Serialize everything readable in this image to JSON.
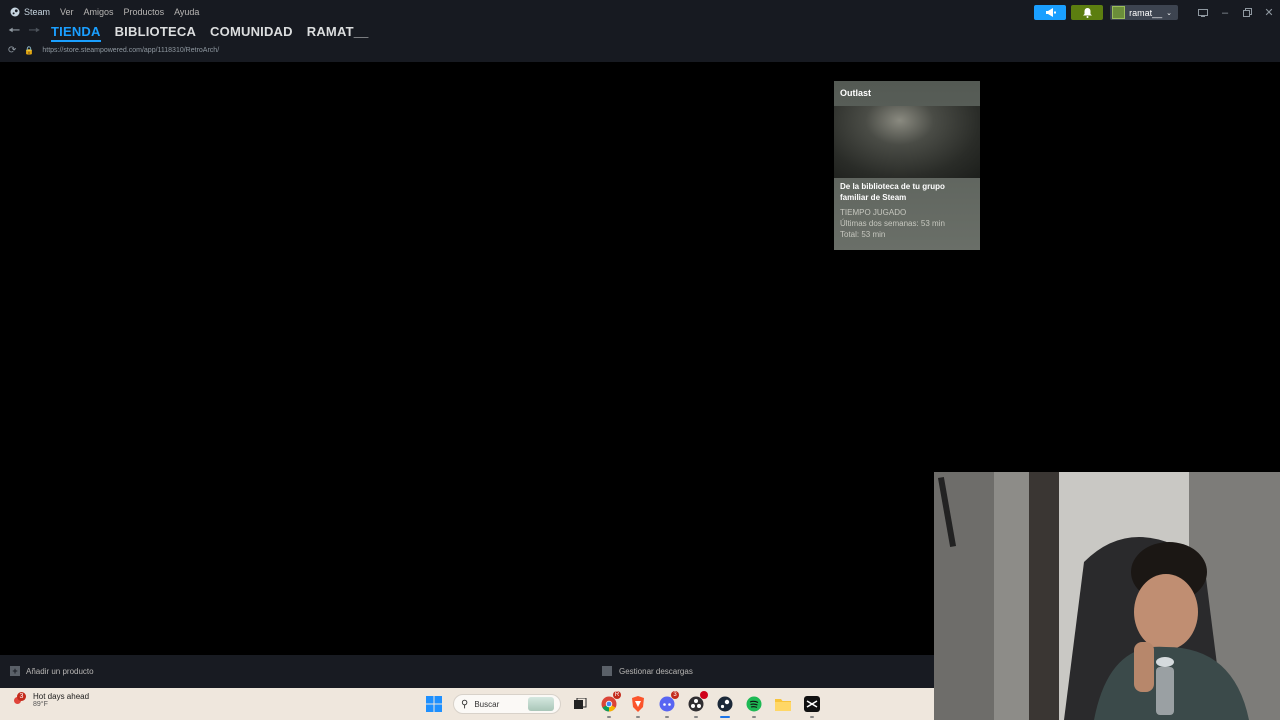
{
  "menubar": {
    "app_name": "Steam",
    "items": [
      "Ver",
      "Amigos",
      "Productos",
      "Ayuda"
    ],
    "account_name": "ramat__"
  },
  "nav": {
    "tabs": [
      "TIENDA",
      "BIBLIOTECA",
      "COMUNIDAD",
      "RAMAT__"
    ],
    "active_tab": "TIENDA",
    "url": "https://store.steampowered.com/app/1118310/RetroArch/"
  },
  "tooltip": {
    "game_title": "Outlast",
    "family_text": "De la biblioteca de tu grupo familiar de Steam",
    "playtime_label": "TIEMPO JUGADO",
    "last_two_weeks": "Últimas dos semanas: 53 min",
    "total": "Total: 53 min"
  },
  "bottombar": {
    "add_product": "Añadir un producto",
    "manage_downloads": "Gestionar descargas"
  },
  "taskbar": {
    "weather_badge": "3",
    "weather_title": "Hot days ahead",
    "weather_temp": "89°F",
    "search_placeholder": "Buscar",
    "chrome_badge": "R",
    "discord_badge": "3"
  },
  "colors": {
    "accent": "#1a9fff",
    "notify_green": "#5c7e10",
    "steam_bg": "#171a21"
  }
}
